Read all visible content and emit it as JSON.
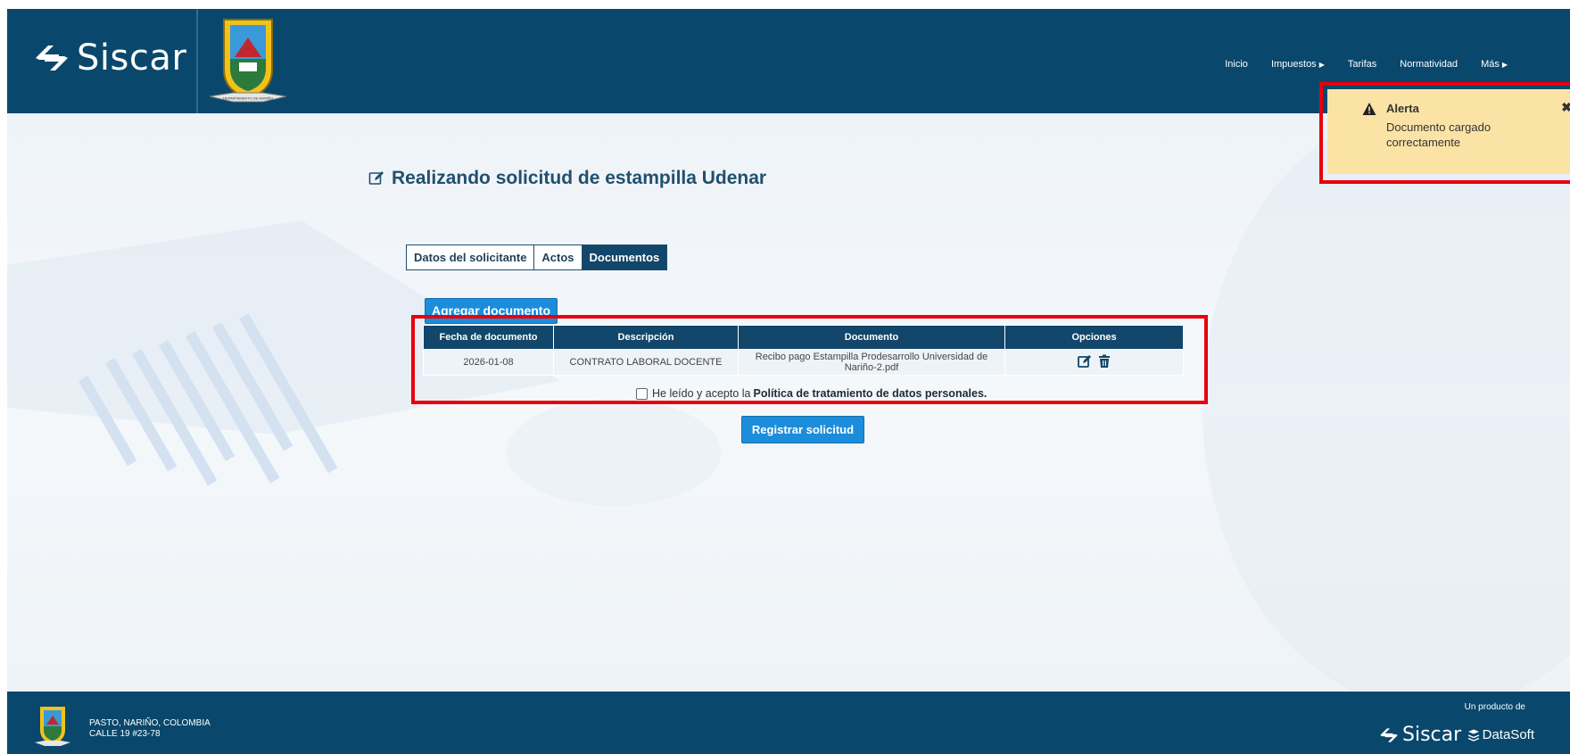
{
  "brand": {
    "name": "Siscar"
  },
  "crest": {
    "ribbon_text": "DEPARTAMENTO DE NARIÑO"
  },
  "nav": {
    "items": [
      {
        "label": "Inicio",
        "has_caret": false
      },
      {
        "label": "Impuestos",
        "has_caret": true
      },
      {
        "label": "Tarifas",
        "has_caret": false
      },
      {
        "label": "Normatividad",
        "has_caret": false
      },
      {
        "label": "Más",
        "has_caret": true
      }
    ],
    "caret": "▶"
  },
  "alert": {
    "title": "Alerta",
    "message": "Documento cargado correctamente",
    "close": "✖"
  },
  "page": {
    "title": "Realizando solicitud de estampilla Udenar"
  },
  "tabs": [
    {
      "label": "Datos del solicitante",
      "active": false
    },
    {
      "label": "Actos",
      "active": false
    },
    {
      "label": "Documentos",
      "active": true
    }
  ],
  "actions": {
    "add_document": "Agregar documento",
    "register": "Registrar solicitud"
  },
  "table": {
    "headers": [
      "Fecha de documento",
      "Descripción",
      "Documento",
      "Opciones"
    ],
    "rows": [
      {
        "date": "2026-01-08",
        "description": "CONTRATO LABORAL DOCENTE",
        "document": "Recibo pago Estampilla Prodesarrollo Universidad de Nariño-2.pdf",
        "options": [
          "edit-icon",
          "trash-icon"
        ]
      }
    ]
  },
  "consent": {
    "prefix": "He leído y acepto la",
    "link": "Política de tratamiento de datos personales.",
    "checked": false
  },
  "footer": {
    "city": "PASTO, NARIÑO, COLOMBIA",
    "address": "CALLE 19 #23-78",
    "product_of": "Un producto de",
    "siscar": "Siscar",
    "company": "DataSoft"
  },
  "colors": {
    "header_bg": "#09486c",
    "accent": "#1c8ddb",
    "alert_bg": "#fbe3a6",
    "highlight": "#e8000b"
  }
}
